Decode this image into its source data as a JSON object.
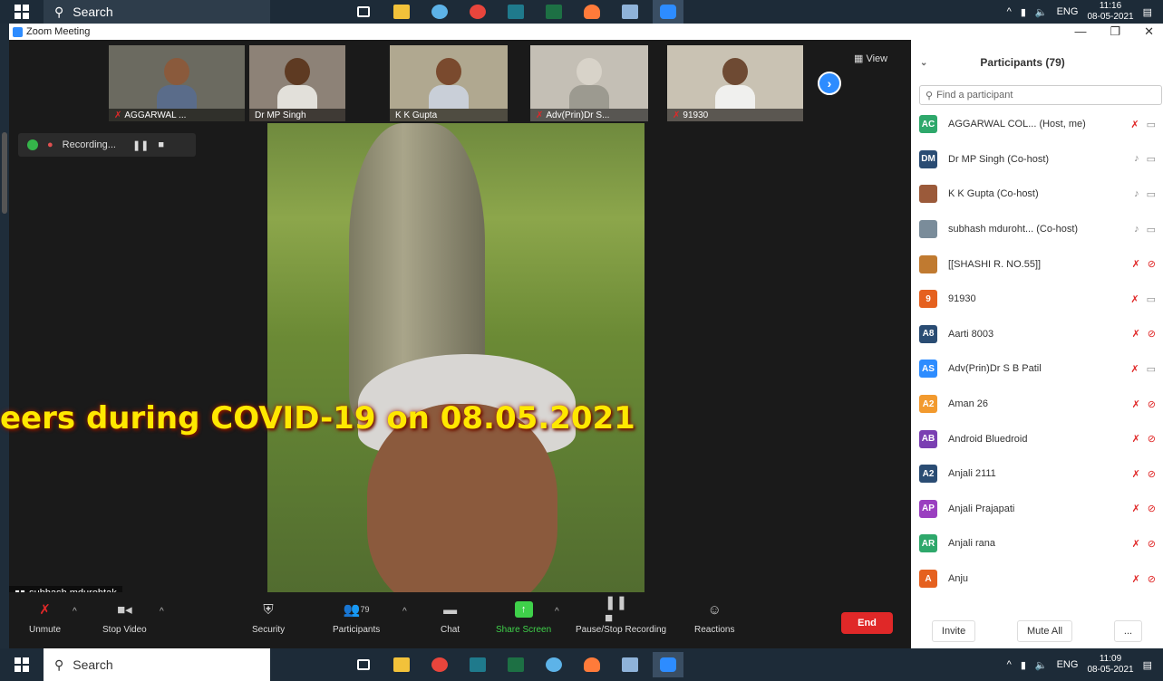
{
  "taskbar_top": {
    "search_label": "Search",
    "tray_lang": "ENG",
    "clock_time": "11:16",
    "clock_date": "08-05-2021"
  },
  "taskbar_bottom": {
    "search_label": "Search",
    "tray_lang": "ENG",
    "clock_time": "11:09",
    "clock_date": "08-05-2021"
  },
  "window": {
    "title": "Zoom Meeting",
    "minimize": "—",
    "maximize": "❐",
    "close": "✕"
  },
  "gallery": {
    "view_label": "View",
    "thumbnails": [
      {
        "name": "AGGARWAL ...",
        "muted": true
      },
      {
        "name": "Dr MP Singh",
        "muted": false
      },
      {
        "name": "K K Gupta",
        "muted": false
      },
      {
        "name": "Adv(Prin)Dr S...",
        "muted": true
      },
      {
        "name": "91930",
        "muted": true
      }
    ]
  },
  "recording": {
    "label": "Recording...",
    "pause": "❚❚",
    "stop": "■"
  },
  "speaker": {
    "name": "subhash mdurohtak"
  },
  "caption": {
    "text": "eers during COVID-19 on 08.05.2021"
  },
  "toolbar": {
    "unmute": "Unmute",
    "stop_video": "Stop Video",
    "security": "Security",
    "participants": "Participants",
    "participants_count": "79",
    "chat": "Chat",
    "share_screen": "Share Screen",
    "pause_stop_recording": "Pause/Stop Recording",
    "reactions": "Reactions",
    "end": "End"
  },
  "participants_panel": {
    "title": "Participants (79)",
    "search_placeholder": "Find a participant",
    "invite": "Invite",
    "mute_all": "Mute All",
    "more": "...",
    "items": [
      {
        "initials": "AC",
        "color": "#2ea86b",
        "name": "AGGARWAL COL... (Host, me)",
        "mic": "muted",
        "video": "on"
      },
      {
        "initials": "DM",
        "color": "#2a4c73",
        "name": "Dr MP Singh (Co-host)",
        "mic": "on",
        "video": "on"
      },
      {
        "initials": "",
        "color": "#9b5a3a",
        "name": "K K Gupta (Co-host)",
        "mic": "on",
        "video": "on"
      },
      {
        "initials": "",
        "color": "#7a8c9a",
        "name": "subhash mduroht... (Co-host)",
        "mic": "on",
        "video": "on"
      },
      {
        "initials": "",
        "color": "#c07a30",
        "name": "[[SHASHI R. NO.55]]",
        "mic": "muted",
        "video": "off"
      },
      {
        "initials": "9",
        "color": "#e5611f",
        "name": "91930",
        "mic": "muted",
        "video": "on"
      },
      {
        "initials": "A8",
        "color": "#2a4c73",
        "name": "Aarti 8003",
        "mic": "muted",
        "video": "off"
      },
      {
        "initials": "AS",
        "color": "#2d8cff",
        "name": "Adv(Prin)Dr S B Patil",
        "mic": "muted",
        "video": "on"
      },
      {
        "initials": "A2",
        "color": "#f29a2e",
        "name": "Aman 26",
        "mic": "muted",
        "video": "off"
      },
      {
        "initials": "AB",
        "color": "#7a3fb2",
        "name": "Android Bluedroid",
        "mic": "muted",
        "video": "off"
      },
      {
        "initials": "A2",
        "color": "#2a4c73",
        "name": "Anjali 2111",
        "mic": "muted",
        "video": "off"
      },
      {
        "initials": "AP",
        "color": "#9a3fc0",
        "name": "Anjali Prajapati",
        "mic": "muted",
        "video": "off"
      },
      {
        "initials": "AR",
        "color": "#2ea86b",
        "name": "Anjali rana",
        "mic": "muted",
        "video": "off"
      },
      {
        "initials": "A",
        "color": "#e5611f",
        "name": "Anju",
        "mic": "muted",
        "video": "off"
      }
    ]
  },
  "colors": {
    "zoom_blue": "#2d8cff",
    "end_red": "#e02828",
    "share_green": "#3fd14a",
    "caption_yellow": "#ffe800"
  }
}
